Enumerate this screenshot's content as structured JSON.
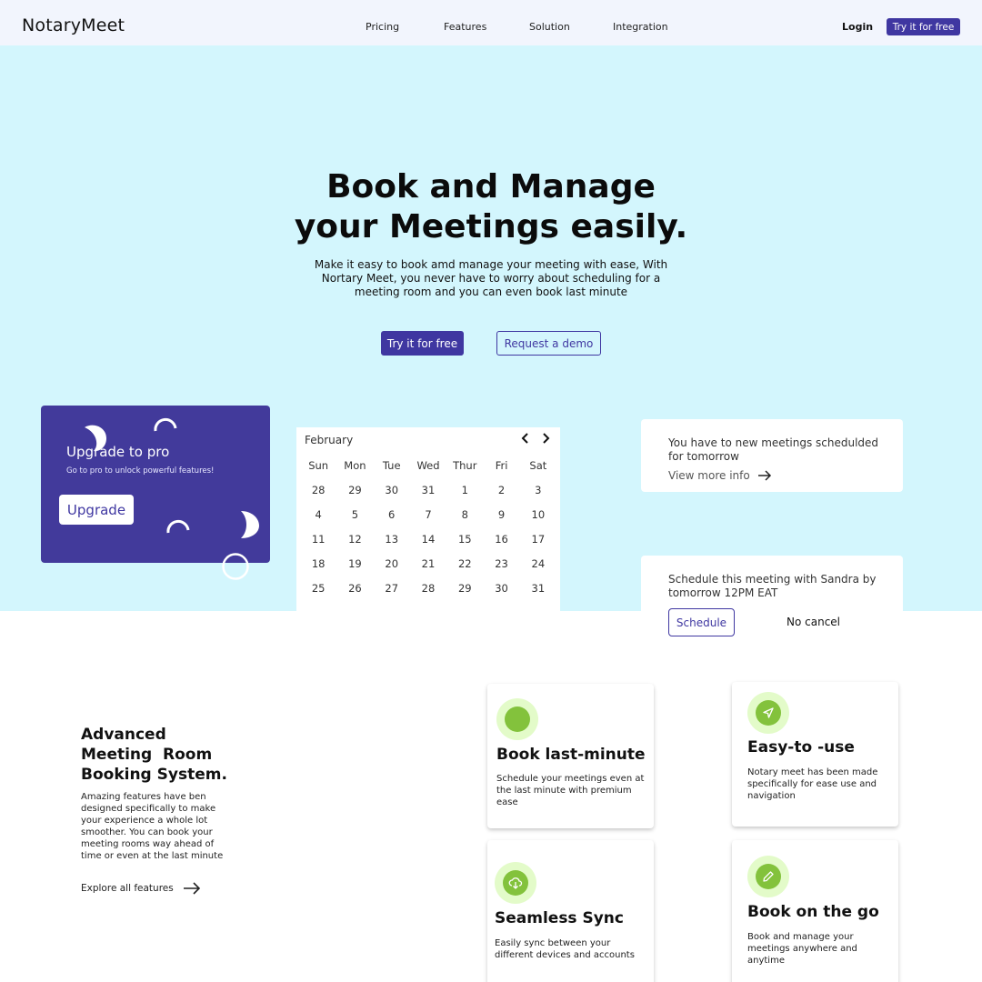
{
  "nav": {
    "logo": "NotaryMeet",
    "links": [
      "Pricing",
      "Features",
      "Solution",
      "Integration"
    ],
    "login": "Login",
    "cta": "Try it for free"
  },
  "hero": {
    "title_line1": "Book and Manage",
    "title_line2": "your Meetings easily.",
    "subtitle": "Make it easy to book amd manage your meeting with ease, With Nortary Meet, you never have to worry about scheduling for a meeting room and you can  even book last minute",
    "primary_button": "Try it for free",
    "secondary_button": "Request a demo",
    "background_color": "#d3f6fd",
    "accent_color": "#3f37a1"
  },
  "upgrade": {
    "title": "Upgrade to pro",
    "subtitle": "Go to pro to unlock powerful features!",
    "button": "Upgrade"
  },
  "calendar": {
    "month": "February",
    "weekdays": [
      "Sun",
      "Mon",
      "Tue",
      "Wed",
      "Thur",
      "Fri",
      "Sat"
    ],
    "weeks": [
      [
        "28",
        "29",
        "30",
        "31",
        "1",
        "2",
        "3"
      ],
      [
        "4",
        "5",
        "6",
        "7",
        "8",
        "9",
        "10"
      ],
      [
        "11",
        "12",
        "13",
        "14",
        "15",
        "16",
        "17"
      ],
      [
        "18",
        "19",
        "20",
        "21",
        "22",
        "23",
        "24"
      ],
      [
        "25",
        "26",
        "27",
        "28",
        "29",
        "30",
        "31"
      ]
    ]
  },
  "notifications": {
    "meetings": {
      "text": "You have to new meetings schedulded  for tomorrow",
      "link": "View more info"
    },
    "schedule": {
      "text": "Schedule this meeting  with Sandra by tomorrow 12PM EAT",
      "schedule_button": "Schedule",
      "cancel_button": "No cancel"
    }
  },
  "features": {
    "title": "Advanced\nMeeting  Room\nBooking System.",
    "description": "Amazing features have ben designed specifically to make your experience a whole lot smoother. You can book your meeting rooms way ahead of time or even at the last minute",
    "link": "Explore all features",
    "cards": [
      {
        "icon": "circle-icon",
        "title": "Book last-minute",
        "desc": "Schedule your meetings  even at the last minute with premium ease"
      },
      {
        "icon": "send-icon",
        "title": "Easy-to -use",
        "desc": "Notary meet has been made specifically for ease use and navigation"
      },
      {
        "icon": "cloud-sync-icon",
        "title": "Seamless Sync",
        "desc": "Easily sync between your different devices and accounts"
      },
      {
        "icon": "pencil-icon",
        "title": "Book on the go",
        "desc": "Book and manage your meetings anywhere and anytime"
      }
    ],
    "icon_bg_color": "#e3fbc9",
    "icon_fg_color": "#83c23c"
  }
}
